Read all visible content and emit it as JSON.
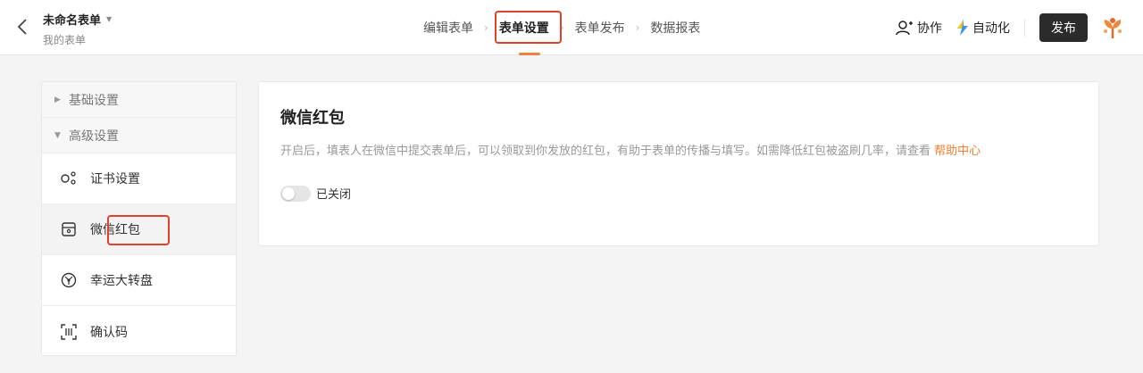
{
  "header": {
    "form_title": "未命名表单",
    "form_subtitle": "我的表单",
    "steps": [
      "编辑表单",
      "表单设置",
      "表单发布",
      "数据报表"
    ],
    "active_step": 1,
    "collab_label": "协作",
    "automation_label": "自动化",
    "publish_label": "发布"
  },
  "sidebar": {
    "groups": [
      {
        "label": "基础设置",
        "expanded": false
      },
      {
        "label": "高级设置",
        "expanded": true
      }
    ],
    "items": [
      {
        "label": "证书设置",
        "icon": "certificate-icon"
      },
      {
        "label": "微信红包",
        "icon": "red-packet-icon"
      },
      {
        "label": "幸运大转盘",
        "icon": "lucky-wheel-icon"
      },
      {
        "label": "确认码",
        "icon": "scan-code-icon"
      }
    ],
    "selected_index": 1
  },
  "main": {
    "title": "微信红包",
    "description": "开启后，填表人在微信中提交表单后，可以领取到你发放的红包，有助于表单的传播与填写。如需降低红包被盗刷几率，请查看",
    "help_link": "帮助中心",
    "toggle_label": "已关闭",
    "toggle_on": false
  },
  "colors": {
    "accent": "#f07d2e",
    "highlight_box": "#e0412f",
    "publish_bg": "#2b2b2b"
  }
}
